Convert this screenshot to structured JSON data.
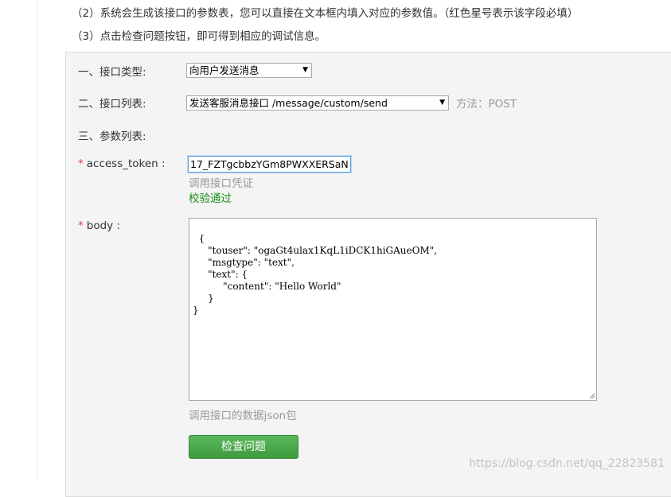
{
  "instructions": {
    "step2": "（2）系统会生成该接口的参数表，您可以直接在文本框内填入对应的参数值。（红色星号表示该字段必填）",
    "step3": "（3）点击检查问题按钮，即可得到相应的调试信息。"
  },
  "form": {
    "interface_type": {
      "label": "一、接口类型:",
      "value": "向用户发送消息"
    },
    "interface_list": {
      "label": "二、接口列表:",
      "value": "发送客服消息接口 /message/custom/send",
      "method": "方法：POST"
    },
    "param_list_label": "三、参数列表:",
    "access_token": {
      "required_mark": "*",
      "label": "access_token :",
      "value": "17_FZTgcbbzYGm8PWXXERSaN",
      "hint": "调用接口凭证",
      "validation": "校验通过"
    },
    "body": {
      "required_mark": "*",
      "label": "body :",
      "value": "{\n     \"touser\": \"ogaGt4ulax1KqL1iDCK1hiGAueOM\",\n     \"msgtype\": \"text\",\n     \"text\": {\n          \"content\": \"Hello World\"\n     }\n}",
      "hint": "调用接口的数据json包"
    },
    "check_button": "检查问题"
  },
  "watermark": "https://blog.csdn.net/qq_22823581",
  "colors": {
    "required": "#e4393c",
    "success": "#1a8d1a",
    "button": "#4cae4c",
    "hint": "#999999"
  }
}
